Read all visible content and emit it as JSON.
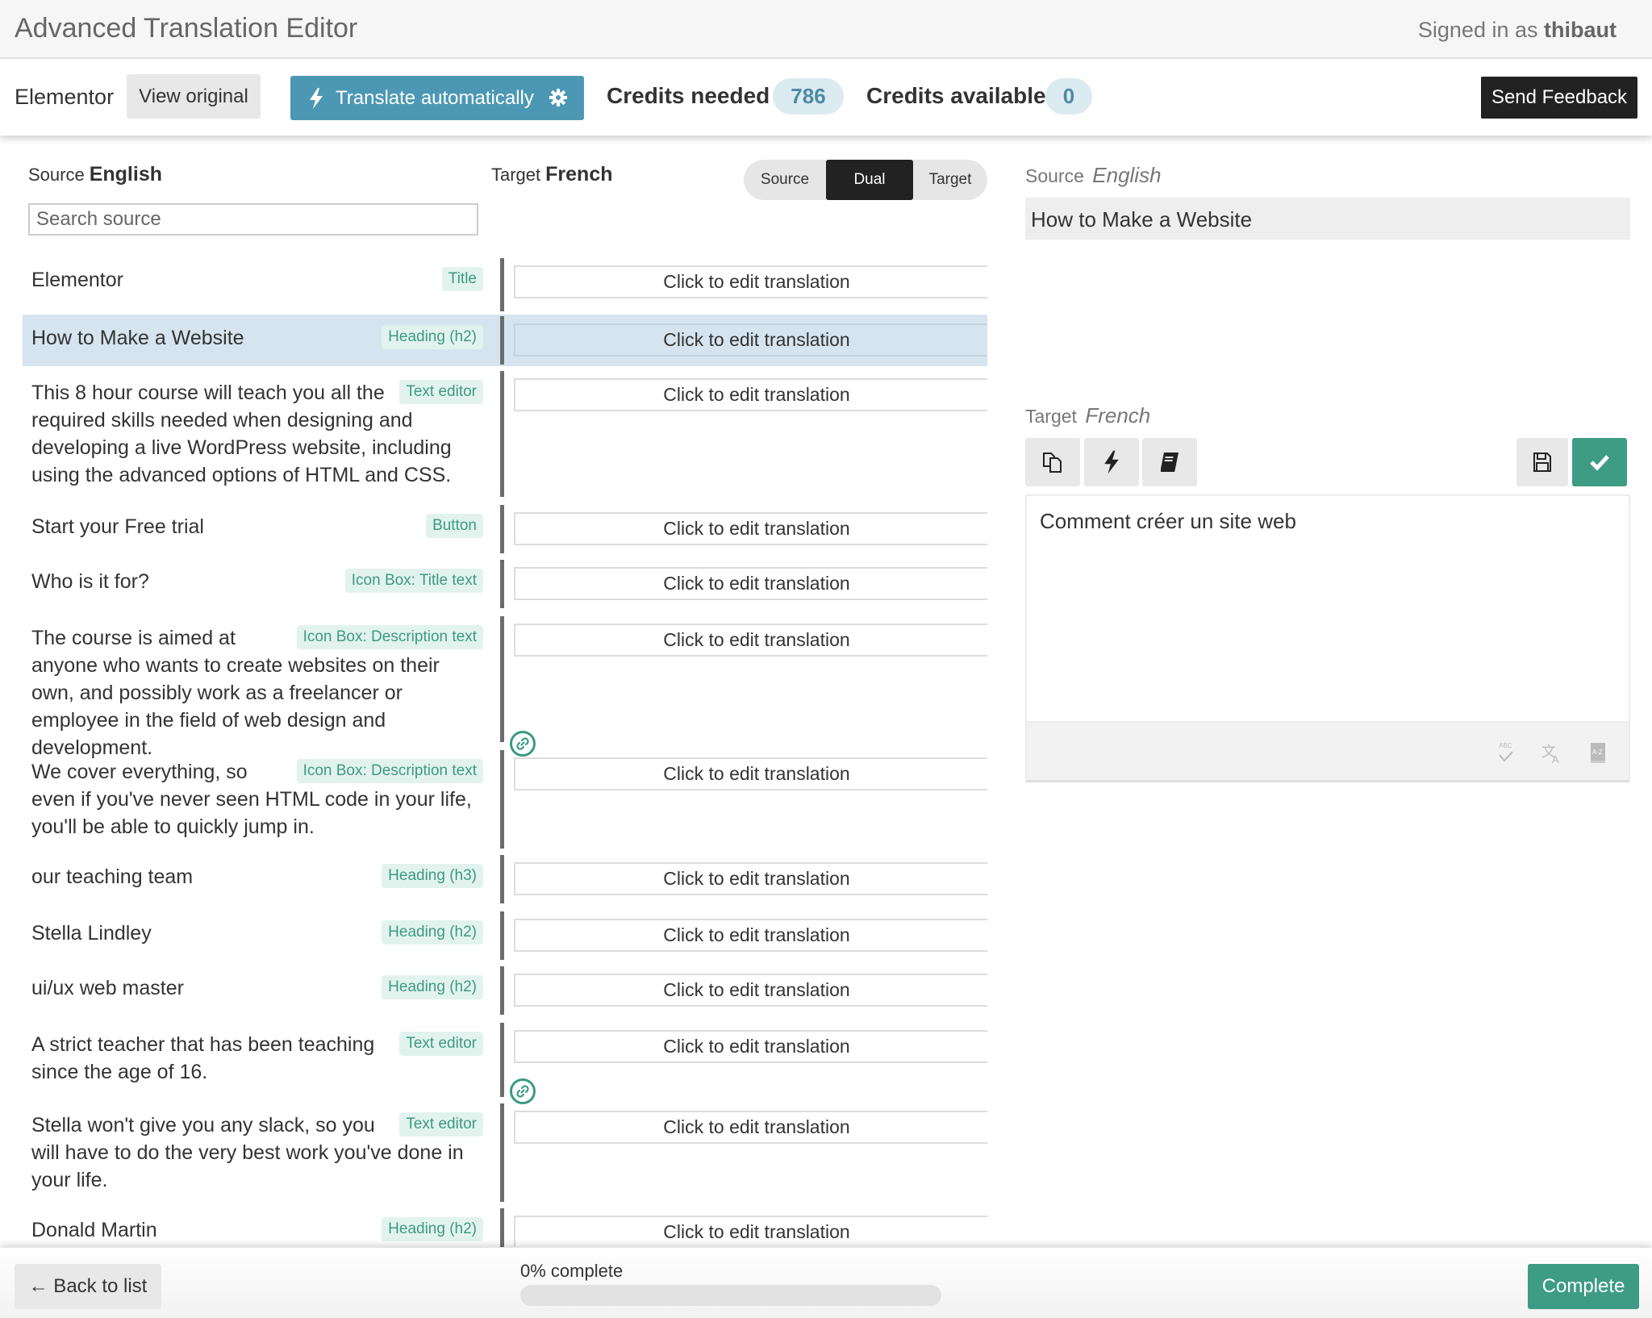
{
  "app": {
    "title": "Advanced Translation Editor",
    "signed_in_prefix": "Signed in as",
    "username": "thibaut"
  },
  "toolbar": {
    "document_name": "Elementor",
    "view_original_label": "View original",
    "translate_auto_label": "Translate automatically",
    "credits_needed_label": "Credits needed",
    "credits_needed_value": "786",
    "credits_available_label": "Credits available",
    "credits_available_value": "0",
    "send_feedback_label": "Send Feedback"
  },
  "list_header": {
    "source_prefix": "Source",
    "source_language": "English",
    "target_prefix": "Target",
    "target_language": "French",
    "search_placeholder": "Search source",
    "view_modes": [
      "Source",
      "Dual",
      "Target"
    ],
    "active_view_mode": "Dual"
  },
  "rows": [
    {
      "source": "Elementor",
      "type": "Title",
      "translation": "Click to edit translation",
      "selected": false
    },
    {
      "source": "How to Make a Website",
      "type": "Heading (h2)",
      "translation": "Click to edit translation",
      "selected": true
    },
    {
      "source": "This 8 hour course will teach you all the required skills needed when designing and developing a live WordPress website, including using the advanced options of HTML and CSS.",
      "type": "Text editor",
      "translation": "Click to edit translation",
      "selected": false
    },
    {
      "source": "Start your Free trial",
      "type": "Button",
      "translation": "Click to edit translation",
      "selected": false
    },
    {
      "source": "Who is it for?",
      "type": "Icon Box: Title text",
      "translation": "Click to edit translation",
      "selected": false
    },
    {
      "source": "The course is aimed at anyone who wants to create websites on their own, and possibly work as a freelancer or employee in the field of web design and development.",
      "type": "Icon Box: Description text",
      "translation": "Click to edit translation",
      "selected": false
    },
    {
      "source": "We cover everything, so even if you've never seen HTML code in your life, you'll be able to quickly jump in.",
      "type": "Icon Box: Description text",
      "translation": "Click to edit translation",
      "selected": false
    },
    {
      "source": "our teaching team",
      "type": "Heading (h3)",
      "translation": "Click to edit translation",
      "selected": false
    },
    {
      "source": "Stella Lindley",
      "type": "Heading (h2)",
      "translation": "Click to edit translation",
      "selected": false
    },
    {
      "source": "ui/ux web master",
      "type": "Heading (h2)",
      "translation": "Click to edit translation",
      "selected": false
    },
    {
      "source": "A strict teacher that has been teaching since the age of 16.",
      "type": "Text editor",
      "translation": "Click to edit translation",
      "selected": false
    },
    {
      "source": "Stella won't give you any slack, so you will have to do the very best work you've done in your life.",
      "type": "Text editor",
      "translation": "Click to edit translation",
      "selected": false
    },
    {
      "source": "Donald Martin",
      "type": "Heading (h2)",
      "translation": "Click to edit translation",
      "selected": false
    }
  ],
  "link_markers": [
    "link-icon",
    "link-icon"
  ],
  "detail": {
    "source_prefix": "Source",
    "source_language": "English",
    "source_text": "How to Make a Website",
    "target_prefix": "Target",
    "target_language": "French",
    "target_text": "Comment créer un site web",
    "tools": [
      "copy-source-icon",
      "machine-translate-icon",
      "glossary-icon"
    ],
    "actions": [
      "save-icon",
      "confirm-check-icon"
    ],
    "editor_footer_icons": [
      "spellcheck-icon",
      "translate-icon",
      "dictionary-icon"
    ]
  },
  "footer": {
    "back_label": "← Back to list",
    "progress_label": "0% complete",
    "progress_percent": 0,
    "complete_label": "Complete"
  },
  "colors": {
    "accent_blue": "#4c98b4",
    "accent_green": "#3e9c84",
    "badge_bg": "#e2f3ee",
    "badge_text": "#3e9a80",
    "selected_row": "#d5e4ee"
  }
}
